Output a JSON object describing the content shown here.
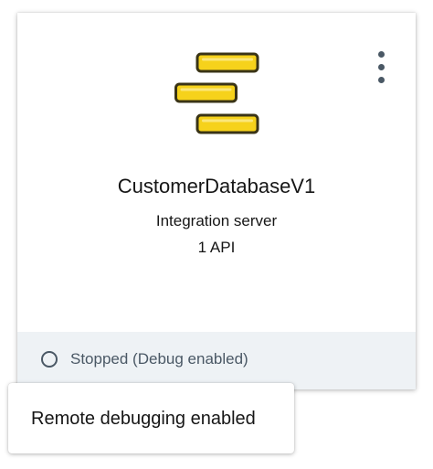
{
  "card": {
    "icon": "integration-server-icon",
    "name": "CustomerDatabaseV1",
    "type": "Integration server",
    "api_count": "1 API",
    "menu_icon": "overflow-menu-vertical-icon",
    "status": {
      "icon": "circle-outline-stopped-icon",
      "text": "Stopped (Debug enabled)"
    }
  },
  "tooltip": {
    "text": "Remote debugging enabled"
  },
  "colors": {
    "logo_fill": "#f6d21b",
    "logo_stroke": "#3a3416",
    "footer_bg": "#eef2f5",
    "status_gray": "#4a5865"
  }
}
